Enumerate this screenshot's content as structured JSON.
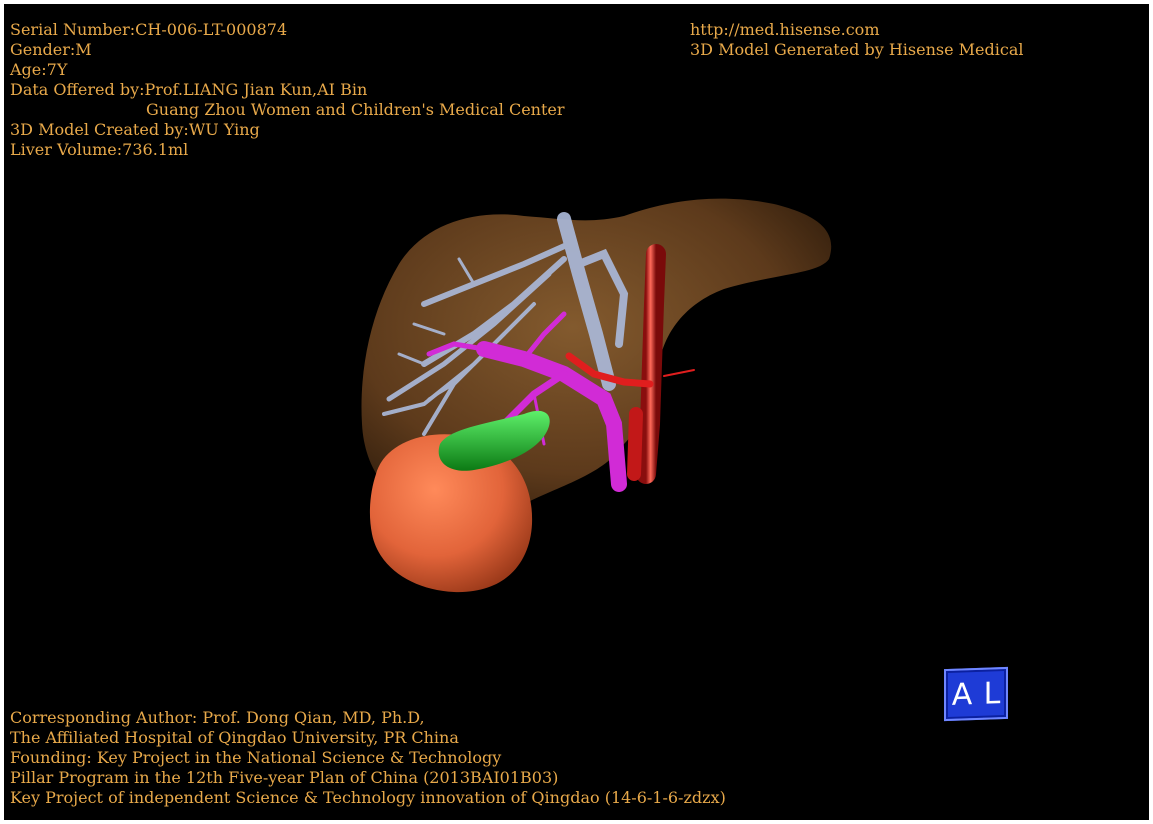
{
  "header_left": {
    "serial": "Serial Number:CH-006-LT-000874",
    "gender": "Gender:M",
    "age": "Age:7Y",
    "data_offered": "Data Offered by:Prof.LIANG Jian Kun,AI Bin",
    "center": "Guang Zhou Women and Children's Medical Center",
    "model_created": "3D Model Created by:WU Ying",
    "liver_volume": "Liver Volume:736.1ml"
  },
  "header_right": {
    "url": "http://med.hisense.com",
    "generated_by": "3D Model Generated by Hisense Medical"
  },
  "footer": {
    "line1": "Corresponding Author: Prof. Dong Qian, MD, Ph.D,",
    "line2": "The Affiliated Hospital of Qingdao University, PR China",
    "line3": "Founding: Key Project in the National Science & Technology",
    "line4": "Pillar Program in the 12th Five-year Plan of China (2013BAI01B03)",
    "line5": "Key Project of independent Science & Technology innovation of Qingdao (14-6-1-6-zdzx)"
  },
  "orientation_cube": {
    "left_label": "A",
    "right_label": "L"
  },
  "colors": {
    "text": "#e8a94a",
    "background": "#000000",
    "liver": "#8a5a2a",
    "tumor": "#e2643a",
    "gallbladder": "#1fb82a",
    "portal_vein": "#d12bd6",
    "hepatic_vein": "#aab8d8",
    "artery": "#e01e1e",
    "cube": "#1e3bd6"
  }
}
